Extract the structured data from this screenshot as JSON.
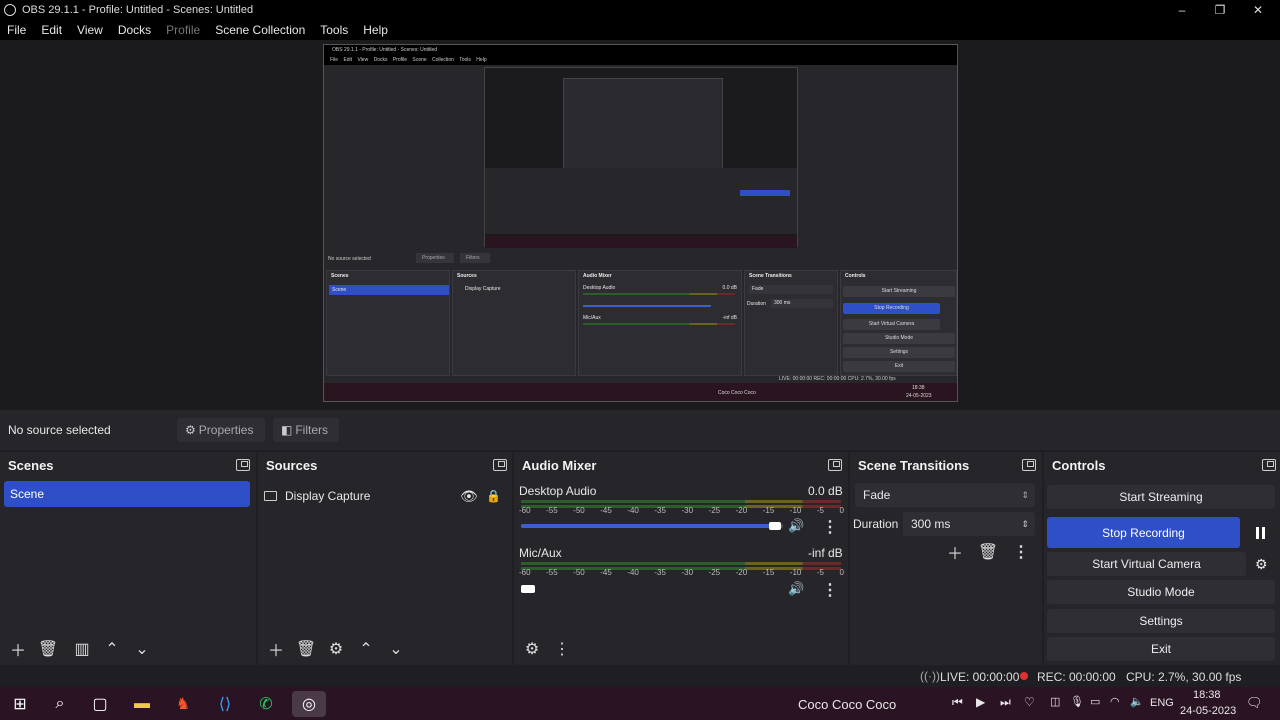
{
  "window": {
    "title": "OBS 29.1.1 - Profile: Untitled - Scenes: Untitled",
    "minimize": "–",
    "maximize": "❐",
    "close": "✕"
  },
  "menu": [
    "File",
    "Edit",
    "View",
    "Docks",
    "Profile",
    "Scene Collection",
    "Tools",
    "Help"
  ],
  "nested": {
    "title": "OBS 29.1.1 - Profile: Untitled - Scenes: Untitled",
    "menu": "File Edit View Docks Profile Scene Collection Tools Help",
    "no_source": "No source selected",
    "properties": "Properties",
    "filters": "Filters",
    "scenes": "Scenes",
    "scene": "Scene",
    "sources": "Sources",
    "display_capture": "Display Capture",
    "audio_mixer": "Audio Mixer",
    "desktop_audio": "Desktop Audio",
    "desktop_db": "0.0 dB",
    "mic": "Mic/Aux",
    "mic_db": "-inf dB",
    "transitions": "Scene Transitions",
    "fade": "Fade",
    "duration": "Duration",
    "duration_val": "300 ms",
    "controls": "Controls",
    "start_streaming": "Start Streaming",
    "stop_recording": "Stop Recording",
    "start_virtual_camera": "Start Virtual Camera",
    "studio_mode": "Studio Mode",
    "settings": "Settings",
    "exit": "Exit",
    "status": "LIVE: 00:00:00   REC: 00:00:00   CPU: 2.7%, 30.00 fps",
    "music": "Coco Coco Coco",
    "clock": "18:38",
    "date": "24-05-2023"
  },
  "source_bar": {
    "label": "No source selected",
    "properties": "Properties",
    "filters": "Filters"
  },
  "scenes": {
    "title": "Scenes",
    "items": [
      "Scene"
    ]
  },
  "sources": {
    "title": "Sources",
    "items": [
      "Display Capture"
    ]
  },
  "audio_mixer": {
    "title": "Audio Mixer",
    "channels": [
      {
        "name": "Desktop Audio",
        "db": "0.0 dB",
        "volume_fraction": 0.98
      },
      {
        "name": "Mic/Aux",
        "db": "-inf dB",
        "volume_fraction": 0.0
      }
    ],
    "ticks": [
      "-60",
      "-55",
      "-50",
      "-45",
      "-40",
      "-35",
      "-30",
      "-25",
      "-20",
      "-15",
      "-10",
      "-5",
      "0"
    ]
  },
  "transitions": {
    "title": "Scene Transitions",
    "selected": "Fade",
    "duration_label": "Duration",
    "duration_value": "300 ms"
  },
  "controls": {
    "title": "Controls",
    "start_streaming": "Start Streaming",
    "stop_recording": "Stop Recording",
    "start_virtual_camera": "Start Virtual Camera",
    "studio_mode": "Studio Mode",
    "settings": "Settings",
    "exit": "Exit"
  },
  "status": {
    "live": "LIVE: 00:00:00",
    "rec": "REC: 00:00:00",
    "cpu": "CPU: 2.7%, 30.00 fps"
  },
  "taskbar": {
    "music": "Coco Coco Coco",
    "lang": "ENG",
    "time": "18:38",
    "date": "24-05-2023"
  },
  "colors": {
    "accent": "#2f4fc9",
    "rec_dot": "#e03030",
    "taskbar": "#2a1322"
  }
}
